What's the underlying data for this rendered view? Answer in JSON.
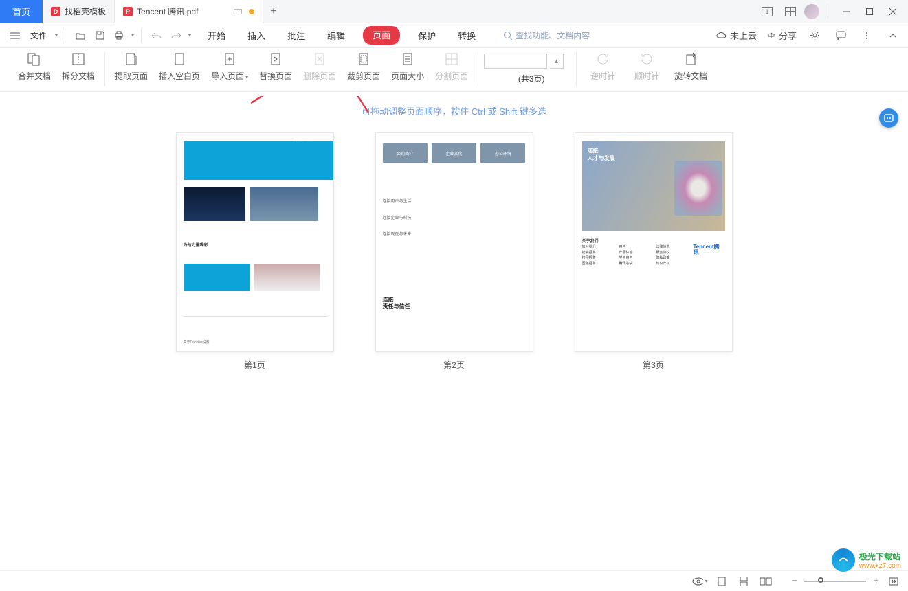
{
  "titlebar": {
    "home_label": "首页",
    "tabs": [
      {
        "label": "找稻壳模板"
      },
      {
        "label": "Tencent 腾讯.pdf"
      }
    ],
    "new_tab": "+"
  },
  "menubar": {
    "file_label": "文件",
    "menu_tabs": [
      "开始",
      "插入",
      "批注",
      "编辑",
      "页面",
      "保护",
      "转换"
    ],
    "active_tab": "页面",
    "search_placeholder": "查找功能、文档内容",
    "cloud_label": "未上云",
    "share_label": "分享"
  },
  "ribbon": {
    "merge": "合并文档",
    "split": "拆分文档",
    "extract": "提取页面",
    "insert_blank": "插入空白页",
    "import": "导入页面",
    "replace": "替换页面",
    "delete": "删除页面",
    "crop": "裁剪页面",
    "page_size": "页面大小",
    "divide": "分割页面",
    "pages_info": "(共3页)",
    "rot_ccw": "逆时针",
    "rot_cw": "顺时针",
    "rot_doc": "旋转文档"
  },
  "content": {
    "hint": "可拖动调整页面顺序，按住 Ctrl 或 Shift 键多选",
    "page_labels": [
      "第1页",
      "第2页",
      "第3页"
    ],
    "p1_title": "为他力量喝彩",
    "p2_card1": "公司简介",
    "p2_card2": "企业文化",
    "p2_card3": "办公环境",
    "p2_sec1": "连接用户与生活",
    "p2_sec2": "连接企业与科技",
    "p2_sec3": "连接现在与未来",
    "p2_big1": "连接",
    "p2_big2": "责任与信任",
    "p3_hero1": "连接",
    "p3_hero2": "人才与发展",
    "p3_about": "关于我们",
    "p3_c1": "加入我们",
    "p3_c2": "社会招聘",
    "p3_c3": "校园招聘",
    "p3_c4": "国际招聘",
    "p3_cc1": "用户",
    "p3_cc2": "产品体验",
    "p3_cc3": "学生用户",
    "p3_cc4": "腾讯学院",
    "p3_ccc1": "法律信息",
    "p3_ccc2": "服务协议",
    "p3_ccc3": "隐私政策",
    "p3_ccc4": "知识产权",
    "p3_logo": "Tencent腾讯"
  },
  "status": {
    "zoom_minus": "−",
    "zoom_plus": "+"
  },
  "watermark": {
    "title": "极光下载站",
    "url": "www.xz7.com"
  }
}
